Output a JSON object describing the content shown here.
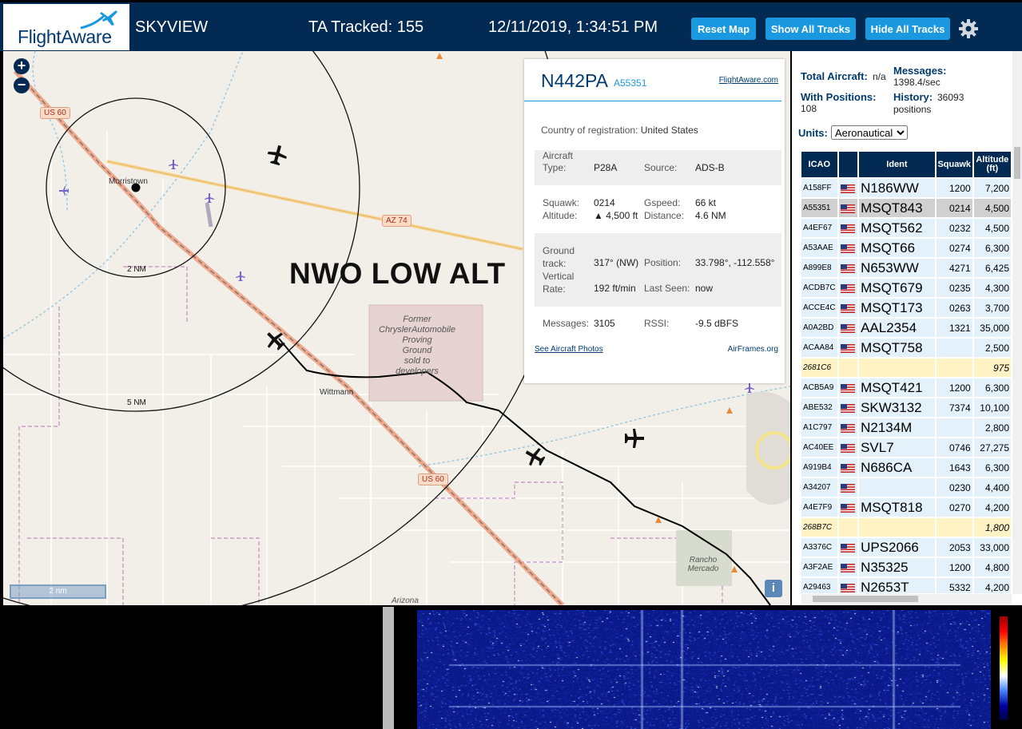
{
  "header": {
    "logo_text": "FlightAware",
    "app_name": "SKYVIEW",
    "tracked": "TA Tracked: 155",
    "datetime": "12/11/2019, 1:34:51 PM",
    "buttons": {
      "reset": "Reset Map",
      "show_all": "Show All Tracks",
      "hide_all": "Hide All Tracks"
    }
  },
  "map": {
    "overlay_label": "NWO LOW ALT",
    "zoom_in": "+",
    "zoom_out": "−",
    "scale": "2 nm",
    "info": "i",
    "range_rings": [
      "2 NM",
      "5 NM"
    ],
    "places": [
      "Morristown",
      "Wittmann",
      "Rancho Mercado",
      "Arizona"
    ],
    "roads": [
      "US 60",
      "AZ 74",
      "US 60"
    ],
    "proving_ground": [
      "Former",
      "ChryslerAutomobile",
      "Proving",
      "Ground",
      "sold to",
      "developers"
    ]
  },
  "popup": {
    "ident": "N442PA",
    "icao": "A55351",
    "fa_link": "FlightAware.com",
    "country_label": "Country of registration:",
    "country": "United States",
    "aircraft_type_label": [
      "Aircraft",
      "Type:"
    ],
    "aircraft_type": "P28A",
    "source_label": "Source:",
    "source": "ADS-B",
    "squawk_label": "Squawk:",
    "squawk": "0214",
    "gspeed_label": "Gspeed:",
    "gspeed": "66 kt",
    "altitude_label": "Altitude:",
    "altitude": "▲ 4,500 ft",
    "distance_label": "Distance:",
    "distance": "4.6 NM",
    "track_label": [
      "Ground",
      "track:"
    ],
    "track": "317° (NW)",
    "position_label": "Position:",
    "position": "33.798°, -112.558°",
    "vrate_label": [
      "Vertical",
      "Rate:"
    ],
    "vrate": "192 ft/min",
    "seen_label": "Last Seen:",
    "seen": "now",
    "messages_label": "Messages:",
    "messages": "3105",
    "rssi_label": "RSSI:",
    "rssi": "-9.5 dBFS",
    "photos_link": "See Aircraft Photos",
    "airframes_link": "AirFrames.org"
  },
  "panel": {
    "total_label": "Total Aircraft:",
    "total": "n/a",
    "messages_label": "Messages:",
    "messages": "1398.4/sec",
    "withpos_label": "With Positions:",
    "withpos": "108",
    "history_label": "History:",
    "history": "36093 positions",
    "units_label": "Units:",
    "units": "Aeronautical",
    "columns": [
      "ICAO",
      "",
      "Ident",
      "Squawk",
      "Altitude (ft)"
    ],
    "rows": [
      {
        "icao": "A158FF",
        "flag": true,
        "ident": "N186WW",
        "squawk": "1200",
        "alt": "7,200",
        "state": ""
      },
      {
        "icao": "A55351",
        "flag": true,
        "ident": "MSQT843",
        "squawk": "0214",
        "alt": "4,500",
        "state": "sel"
      },
      {
        "icao": "A4EF67",
        "flag": true,
        "ident": "MSQT562",
        "squawk": "0232",
        "alt": "4,500",
        "state": ""
      },
      {
        "icao": "A53AAE",
        "flag": true,
        "ident": "MSQT66",
        "squawk": "0274",
        "alt": "6,300",
        "state": ""
      },
      {
        "icao": "A899E8",
        "flag": true,
        "ident": "N653WW",
        "squawk": "4271",
        "alt": "6,425",
        "state": ""
      },
      {
        "icao": "ACDB7C",
        "flag": true,
        "ident": "MSQT679",
        "squawk": "0235",
        "alt": "4,300",
        "state": ""
      },
      {
        "icao": "ACCE4C",
        "flag": true,
        "ident": "MSQT173",
        "squawk": "0263",
        "alt": "3,700",
        "state": ""
      },
      {
        "icao": "A0A2BD",
        "flag": true,
        "ident": "AAL2354",
        "squawk": "1321",
        "alt": "35,000",
        "state": ""
      },
      {
        "icao": "ACAA84",
        "flag": true,
        "ident": "MSQT758",
        "squawk": "",
        "alt": "2,500",
        "state": ""
      },
      {
        "icao": "2681C6",
        "flag": false,
        "ident": "",
        "squawk": "",
        "alt": "975",
        "state": "nopos"
      },
      {
        "icao": "ACB5A9",
        "flag": true,
        "ident": "MSQT421",
        "squawk": "1200",
        "alt": "6,300",
        "state": ""
      },
      {
        "icao": "ABE532",
        "flag": true,
        "ident": "SKW3132",
        "squawk": "7374",
        "alt": "10,100",
        "state": ""
      },
      {
        "icao": "A1C797",
        "flag": true,
        "ident": "N2134M",
        "squawk": "",
        "alt": "2,800",
        "state": ""
      },
      {
        "icao": "AC40EE",
        "flag": true,
        "ident": "SVL7",
        "squawk": "0746",
        "alt": "27,275",
        "state": ""
      },
      {
        "icao": "A919B4",
        "flag": true,
        "ident": "N686CA",
        "squawk": "1643",
        "alt": "6,300",
        "state": ""
      },
      {
        "icao": "A34207",
        "flag": true,
        "ident": "",
        "squawk": "0230",
        "alt": "4,400",
        "state": ""
      },
      {
        "icao": "A4E7F9",
        "flag": true,
        "ident": "MSQT818",
        "squawk": "0270",
        "alt": "4,200",
        "state": ""
      },
      {
        "icao": "268B7C",
        "flag": false,
        "ident": "",
        "squawk": "",
        "alt": "1,800",
        "state": "nopos"
      },
      {
        "icao": "A3376C",
        "flag": true,
        "ident": "UPS2066",
        "squawk": "2053",
        "alt": "33,000",
        "state": ""
      },
      {
        "icao": "A3F2AE",
        "flag": true,
        "ident": "N35325",
        "squawk": "1200",
        "alt": "4,800",
        "state": ""
      },
      {
        "icao": "A29463",
        "flag": true,
        "ident": "N2653T",
        "squawk": "5332",
        "alt": "4,200",
        "state": ""
      }
    ]
  },
  "colors": {
    "header_bg": "#032a52",
    "button": "#1a98e0",
    "row_bg": "#e3f1fa",
    "row_nopos": "#fff3c6",
    "row_selected": "#d0d0d0"
  }
}
